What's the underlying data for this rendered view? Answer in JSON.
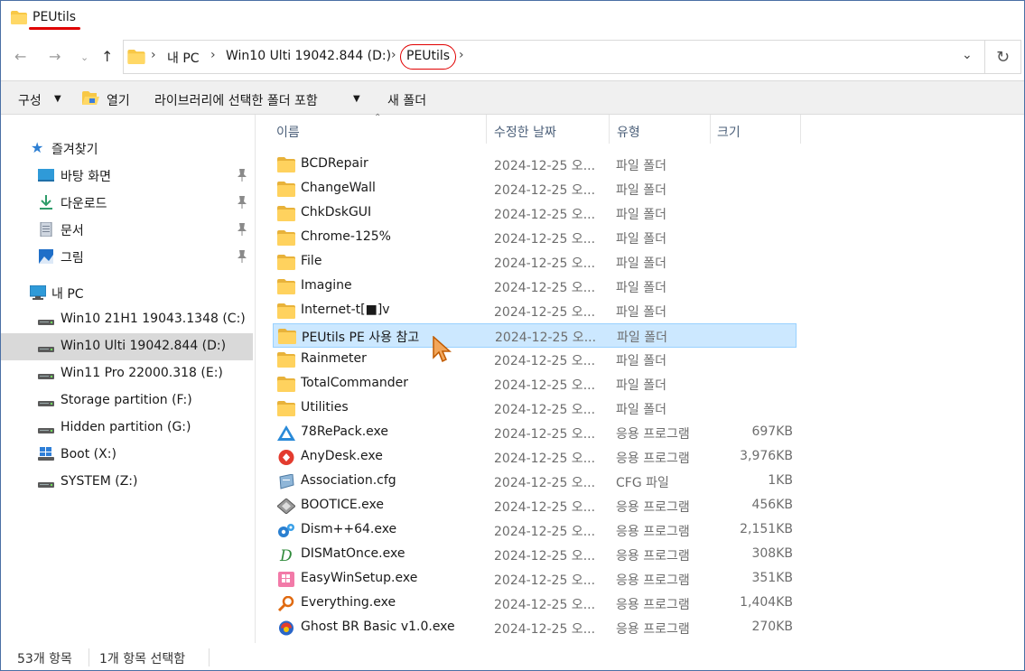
{
  "window": {
    "title": "PEUtils"
  },
  "address": {
    "crumbs": [
      "내 PC",
      "Win10 Ulti 19042.844 (D:)",
      "PEUtils"
    ]
  },
  "toolbar": {
    "organize_label": "구성",
    "open_label": "열기",
    "include_label": "라이브러리에 선택한 폴더 포함",
    "new_folder_label": "새 폴더"
  },
  "sidebar": {
    "quick_access_label": "즐겨찾기",
    "pinned": [
      {
        "label": "바탕 화면",
        "icon": "desktop-icon"
      },
      {
        "label": "다운로드",
        "icon": "download-icon"
      },
      {
        "label": "문서",
        "icon": "documents-icon"
      },
      {
        "label": "그림",
        "icon": "pictures-icon"
      }
    ],
    "this_pc_label": "내 PC",
    "drives": [
      {
        "label": "Win10 21H1 19043.1348 (C:)",
        "icon": "drive-icon"
      },
      {
        "label": "Win10 Ulti 19042.844 (D:)",
        "icon": "drive-icon",
        "selected": true
      },
      {
        "label": "Win11 Pro 22000.318 (E:)",
        "icon": "drive-icon"
      },
      {
        "label": "Storage partition (F:)",
        "icon": "drive-icon"
      },
      {
        "label": "Hidden partition (G:)",
        "icon": "drive-icon"
      },
      {
        "label": "Boot (X:)",
        "icon": "windows-drive-icon"
      },
      {
        "label": "SYSTEM (Z:)",
        "icon": "drive-icon"
      }
    ]
  },
  "columns": {
    "name": "이름",
    "date": "수정한 날짜",
    "type": "유형",
    "size": "크기"
  },
  "files": [
    {
      "name": "BCDRepair",
      "date": "2024-12-25 오...",
      "type": "파일 폴더",
      "size": "",
      "icon": "folder-icon"
    },
    {
      "name": "ChangeWall",
      "date": "2024-12-25 오...",
      "type": "파일 폴더",
      "size": "",
      "icon": "folder-icon"
    },
    {
      "name": "ChkDskGUI",
      "date": "2024-12-25 오...",
      "type": "파일 폴더",
      "size": "",
      "icon": "folder-icon"
    },
    {
      "name": "Chrome-125%",
      "date": "2024-12-25 오...",
      "type": "파일 폴더",
      "size": "",
      "icon": "folder-icon"
    },
    {
      "name": "File",
      "date": "2024-12-25 오...",
      "type": "파일 폴더",
      "size": "",
      "icon": "folder-icon"
    },
    {
      "name": "Imagine",
      "date": "2024-12-25 오...",
      "type": "파일 폴더",
      "size": "",
      "icon": "folder-icon"
    },
    {
      "name": "Internet-t[■]v",
      "date": "2024-12-25 오...",
      "type": "파일 폴더",
      "size": "",
      "icon": "folder-icon"
    },
    {
      "name": "PEUtils PE 사용 참고",
      "date": "2024-12-25 오...",
      "type": "파일 폴더",
      "size": "",
      "icon": "folder-icon",
      "selected": true
    },
    {
      "name": "Rainmeter",
      "date": "2024-12-25 오...",
      "type": "파일 폴더",
      "size": "",
      "icon": "folder-icon"
    },
    {
      "name": "TotalCommander",
      "date": "2024-12-25 오...",
      "type": "파일 폴더",
      "size": "",
      "icon": "folder-icon"
    },
    {
      "name": "Utilities",
      "date": "2024-12-25 오...",
      "type": "파일 폴더",
      "size": "",
      "icon": "folder-icon"
    },
    {
      "name": "78RePack.exe",
      "date": "2024-12-25 오...",
      "type": "응용 프로그램",
      "size": "697KB",
      "icon": "triangle-app-icon"
    },
    {
      "name": "AnyDesk.exe",
      "date": "2024-12-25 오...",
      "type": "응용 프로그램",
      "size": "3,976KB",
      "icon": "anydesk-icon"
    },
    {
      "name": "Association.cfg",
      "date": "2024-12-25 오...",
      "type": "CFG 파일",
      "size": "1KB",
      "icon": "config-file-icon"
    },
    {
      "name": "BOOTICE.exe",
      "date": "2024-12-25 오...",
      "type": "응용 프로그램",
      "size": "456KB",
      "icon": "bootice-icon"
    },
    {
      "name": "Dism++64.exe",
      "date": "2024-12-25 오...",
      "type": "응용 프로그램",
      "size": "2,151KB",
      "icon": "gears-icon"
    },
    {
      "name": "DISMatOnce.exe",
      "date": "2024-12-25 오...",
      "type": "응용 프로그램",
      "size": "308KB",
      "icon": "d-letter-icon"
    },
    {
      "name": "EasyWinSetup.exe",
      "date": "2024-12-25 오...",
      "type": "응용 프로그램",
      "size": "351KB",
      "icon": "windows-pink-icon"
    },
    {
      "name": "Everything.exe",
      "date": "2024-12-25 오...",
      "type": "응용 프로그램",
      "size": "1,404KB",
      "icon": "magnifier-icon"
    },
    {
      "name": "Ghost BR Basic v1.0.exe",
      "date": "2024-12-25 오...",
      "type": "응용 프로그램",
      "size": "270KB",
      "icon": "ghost-icon"
    }
  ],
  "status": {
    "items_count": "53개 항목",
    "selected_count": "1개 항목 선택함"
  },
  "colors": {
    "selection_bg": "#cce8ff",
    "selection_border": "#99d1ff",
    "highlight_red": "#e00000",
    "folder_yellow": "#f8c846"
  }
}
